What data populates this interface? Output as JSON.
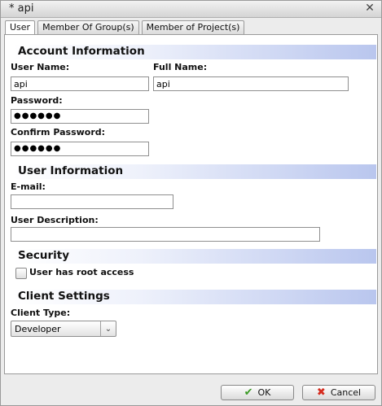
{
  "window": {
    "title": "* api",
    "close_glyph": "✕"
  },
  "tabs": [
    {
      "label": "User",
      "active": true
    },
    {
      "label": "Member Of Group(s)",
      "active": false
    },
    {
      "label": "Member of Project(s)",
      "active": false
    }
  ],
  "account": {
    "heading": "Account Information",
    "user_name_label": "User Name:",
    "user_name_value": "api",
    "full_name_label": "Full Name:",
    "full_name_value": "api",
    "password_label": "Password:",
    "password_value": "●●●●●●",
    "confirm_password_label": "Confirm Password:",
    "confirm_password_value": "●●●●●●"
  },
  "user_info": {
    "heading": "User Information",
    "email_label": "E-mail:",
    "email_value": "",
    "description_label": "User Description:",
    "description_value": ""
  },
  "security": {
    "heading": "Security",
    "root_access_label": "User has root access",
    "root_access_checked": false
  },
  "client": {
    "heading": "Client Settings",
    "client_type_label": "Client Type:",
    "client_type_value": "Developer",
    "dropdown_glyph": "⌄"
  },
  "footer": {
    "ok_label": "OK",
    "ok_icon": "✔",
    "cancel_label": "Cancel",
    "cancel_icon": "✖"
  },
  "colors": {
    "section_gradient_end": "#b9c6ee",
    "ok_icon": "#3a9a24",
    "cancel_icon": "#d52b1e"
  }
}
